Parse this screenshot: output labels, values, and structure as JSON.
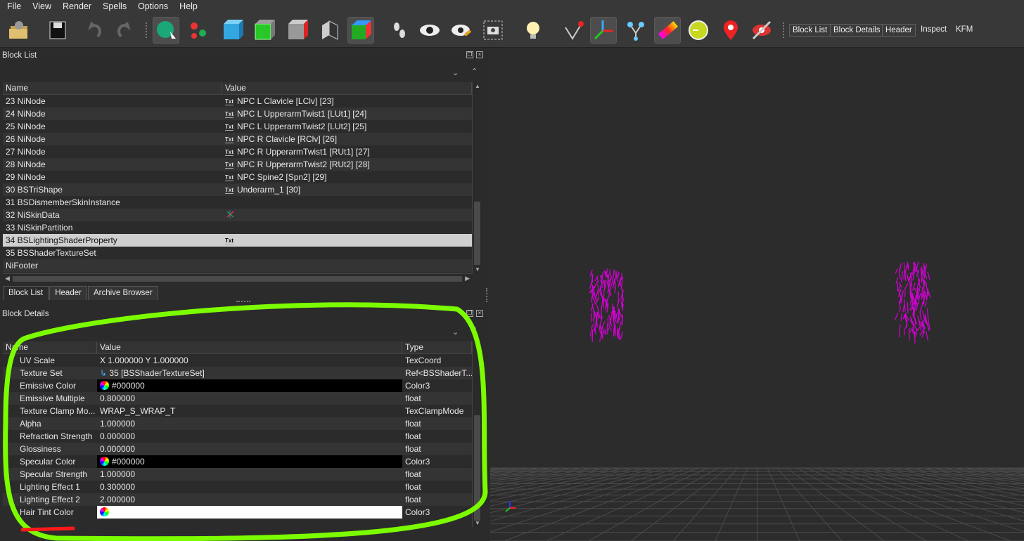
{
  "menu": [
    "File",
    "View",
    "Render",
    "Spells",
    "Options",
    "Help"
  ],
  "toolbar": {
    "text_buttons": [
      "Block List",
      "Block Details",
      "Header"
    ],
    "text_labels": [
      "Inspect",
      "KFM"
    ]
  },
  "block_list": {
    "title": "Block List",
    "columns": [
      "Name",
      "Value"
    ],
    "rows": [
      {
        "name": "23 NiNode",
        "value": "NPC L Clavicle [LClv] [23]",
        "icon": "txt"
      },
      {
        "name": "24 NiNode",
        "value": "NPC L UpperarmTwist1 [LUt1] [24]",
        "icon": "txt"
      },
      {
        "name": "25 NiNode",
        "value": "NPC L UpperarmTwist2 [LUt2] [25]",
        "icon": "txt"
      },
      {
        "name": "26 NiNode",
        "value": "NPC R Clavicle [RClv] [26]",
        "icon": "txt"
      },
      {
        "name": "27 NiNode",
        "value": "NPC R UpperarmTwist1 [RUt1] [27]",
        "icon": "txt"
      },
      {
        "name": "28 NiNode",
        "value": "NPC R UpperarmTwist2 [RUt2] [28]",
        "icon": "txt"
      },
      {
        "name": "29 NiNode",
        "value": "NPC Spine2 [Spn2] [29]",
        "icon": "txt"
      },
      {
        "name": "30 BSTriShape",
        "value": "Underarm_1 [30]",
        "icon": "txt"
      },
      {
        "name": "31 BSDismemberSkinInstance",
        "value": "",
        "icon": ""
      },
      {
        "name": "32 NiSkinData",
        "value": "",
        "icon": "axes"
      },
      {
        "name": "33 NiSkinPartition",
        "value": "",
        "icon": ""
      },
      {
        "name": "34 BSLightingShaderProperty",
        "value": "",
        "icon": "txt"
      },
      {
        "name": "35 BSShaderTextureSet",
        "value": "",
        "icon": ""
      },
      {
        "name": "NiFooter",
        "value": "",
        "icon": ""
      }
    ],
    "selected_index": 11,
    "txt_icon": "Txt"
  },
  "bottom_tabs": [
    "Block List",
    "Header",
    "Archive Browser"
  ],
  "block_details": {
    "title": "Block Details",
    "columns": [
      "Name",
      "Value",
      "Type"
    ],
    "rows": [
      {
        "name": "UV Scale",
        "value": "X 1.000000 Y 1.000000",
        "type": "TexCoord",
        "kind": "text"
      },
      {
        "name": "Texture Set",
        "value": "35 [BSShaderTextureSet]",
        "type": "Ref<BSShaderT...",
        "kind": "link"
      },
      {
        "name": "Emissive Color",
        "value": "#000000",
        "type": "Color3",
        "kind": "color-black"
      },
      {
        "name": "Emissive Multiple",
        "value": "0.800000",
        "type": "float",
        "kind": "text"
      },
      {
        "name": "Texture Clamp Mo...",
        "value": "WRAP_S_WRAP_T",
        "type": "TexClampMode",
        "kind": "text"
      },
      {
        "name": "Alpha",
        "value": "1.000000",
        "type": "float",
        "kind": "text"
      },
      {
        "name": "Refraction Strength",
        "value": "0.000000",
        "type": "float",
        "kind": "text"
      },
      {
        "name": "Glossiness",
        "value": "0.000000",
        "type": "float",
        "kind": "text"
      },
      {
        "name": "Specular Color",
        "value": "#000000",
        "type": "Color3",
        "kind": "color-black"
      },
      {
        "name": "Specular Strength",
        "value": "1.000000",
        "type": "float",
        "kind": "text"
      },
      {
        "name": "Lighting Effect 1",
        "value": "0.300000",
        "type": "float",
        "kind": "text"
      },
      {
        "name": "Lighting Effect 2",
        "value": "2.000000",
        "type": "float",
        "kind": "text"
      },
      {
        "name": "Hair Tint Color",
        "value": "",
        "type": "Color3",
        "kind": "color-white"
      }
    ]
  },
  "colors": {
    "annotation_green": "#7CFC00",
    "annotation_red": "#ff1a1a",
    "mesh_magenta": "#d400d4"
  }
}
